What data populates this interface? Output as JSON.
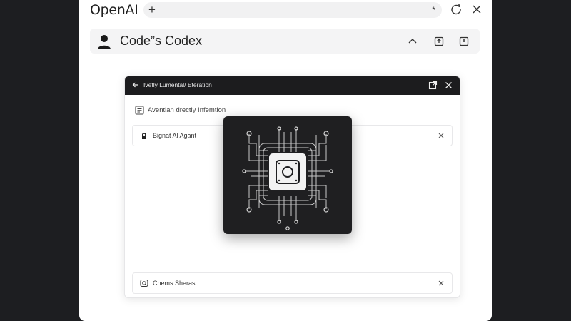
{
  "app": {
    "brand": "OpenAI"
  },
  "tabbar": {
    "new_tab": "+",
    "star": "*"
  },
  "header": {
    "title": "Code”s Codex"
  },
  "dialog": {
    "title": "Ivetly Lumental/ Eteration",
    "info_text": "Aventian drectly Infemtion",
    "items": [
      {
        "label": "Bignat Al Agant"
      },
      {
        "label": "Chems Sheras"
      }
    ]
  },
  "overlay": {
    "icon": "circuit-chip-icon"
  },
  "colors": {
    "page_background": "#1d1e21",
    "window": "#ffffff",
    "dialog_header": "#1c1c1e",
    "overlay": "#1f1f21",
    "chip_face": "#f2f2f2"
  }
}
